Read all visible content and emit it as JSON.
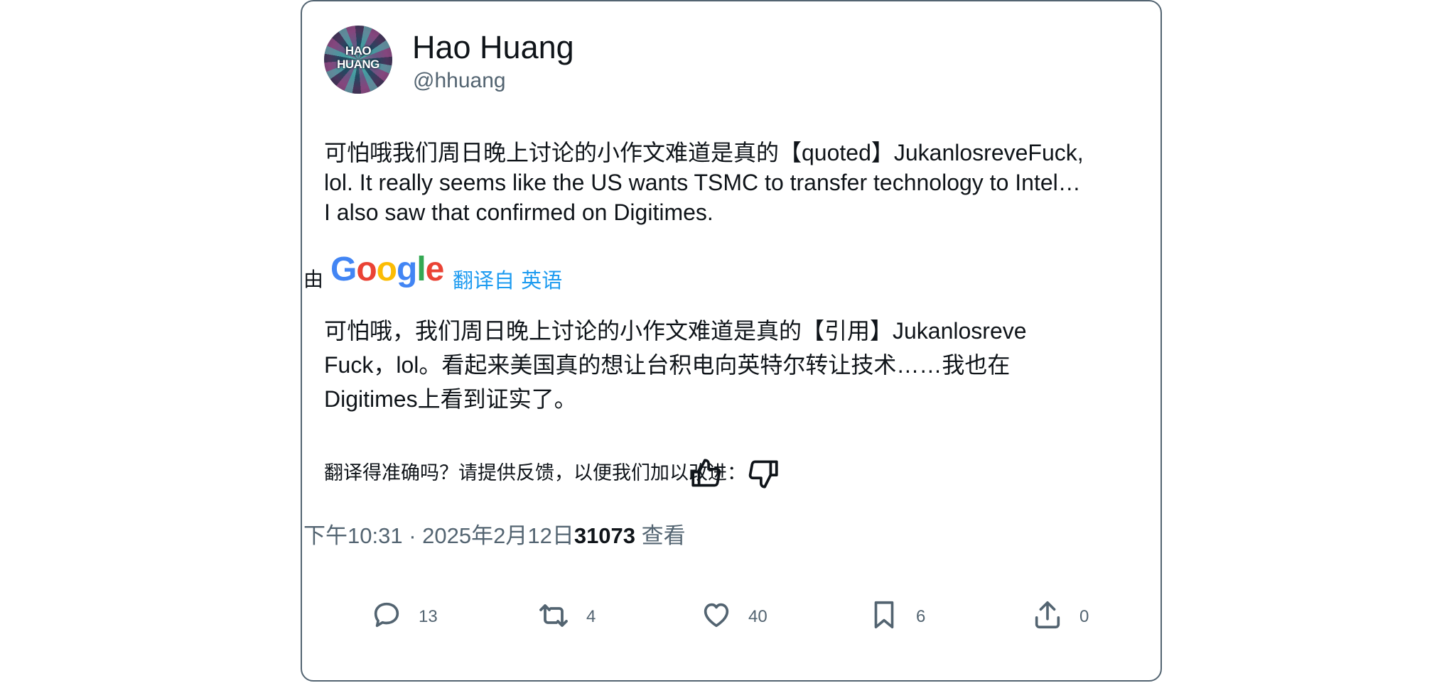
{
  "profile": {
    "avatar_text": "HAO HUANG",
    "name": "Hao Huang",
    "handle": "@hhuang"
  },
  "tweet": {
    "text": "可怕哦我们周日晚上讨论的小作文难道是真的【quoted】JukanlosreveFuck,\nlol. It really seems like the US wants TSMC to transfer technology to Intel…\nI also saw that confirmed on Digitimes."
  },
  "translation_bar": {
    "by_label": "由",
    "logo_text": "Google",
    "link_label": "翻译自 英语"
  },
  "translation": {
    "text": "可怕哦，我们周日晚上讨论的小作文难道是真的【引用】Jukanlosreve\nFuck，lol。看起来美国真的想让台积电向英特尔转让技术……我也在\nDigitimes上看到证实了。"
  },
  "feedback": {
    "prompt": "翻译得准确吗？请提供反馈，以便我们加以改进："
  },
  "meta": {
    "time": "下午10:31",
    "separator": " · ",
    "date": "2025年2月12日",
    "views_count": "31073",
    "views_label": " 查看"
  },
  "actions": {
    "reply_count": "13",
    "retweet_count": "4",
    "like_count": "40",
    "bookmark_count": "6",
    "share_count": "0"
  },
  "colors": {
    "link": "#1d9bf0",
    "secondary_text": "#536471",
    "border": "#536471"
  }
}
